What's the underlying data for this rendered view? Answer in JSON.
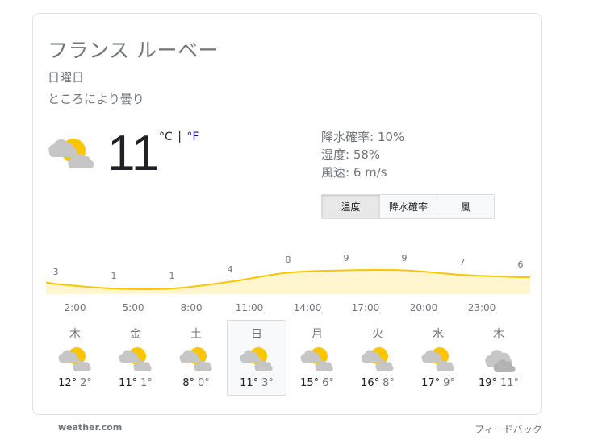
{
  "location": "フランス ルーベー",
  "day": "日曜日",
  "condition": "ところにより曇り",
  "current": {
    "temperature": "11",
    "unit_celsius": "°C",
    "unit_sep": "|",
    "unit_fahrenheit": "°F",
    "icon": "partly-cloudy-icon"
  },
  "details": {
    "precipitation": "降水確率: 10%",
    "humidity": "湿度: 58%",
    "wind": "風速: 6 m/s"
  },
  "tabs": [
    {
      "label": "温度",
      "selected": true
    },
    {
      "label": "降水確率",
      "selected": false
    },
    {
      "label": "風",
      "selected": false
    }
  ],
  "chart_data": {
    "type": "area",
    "x": [
      "2:00",
      "5:00",
      "8:00",
      "11:00",
      "14:00",
      "17:00",
      "20:00",
      "23:00"
    ],
    "values": [
      3,
      1,
      1,
      4,
      8,
      9,
      9,
      7,
      6
    ],
    "value_labels": [
      "3",
      "1",
      "1",
      "4",
      "8",
      "9",
      "9",
      "7",
      "6"
    ],
    "fill_color": "#fff6d0",
    "line_color": "#fbc500"
  },
  "forecast": [
    {
      "day": "木",
      "hi": "12°",
      "lo": "2°",
      "icon": "partly-cloudy-icon"
    },
    {
      "day": "金",
      "hi": "11°",
      "lo": "1°",
      "icon": "partly-cloudy-icon"
    },
    {
      "day": "土",
      "hi": "8°",
      "lo": "0°",
      "icon": "partly-cloudy-icon"
    },
    {
      "day": "日",
      "hi": "11°",
      "lo": "3°",
      "icon": "partly-cloudy-icon",
      "selected": true
    },
    {
      "day": "月",
      "hi": "15°",
      "lo": "6°",
      "icon": "partly-cloudy-icon"
    },
    {
      "day": "火",
      "hi": "16°",
      "lo": "8°",
      "icon": "partly-cloudy-icon"
    },
    {
      "day": "水",
      "hi": "17°",
      "lo": "9°",
      "icon": "partly-cloudy-icon"
    },
    {
      "day": "木",
      "hi": "19°",
      "lo": "11°",
      "icon": "cloudy-icon"
    }
  ],
  "source": "weather.com",
  "feedback": "フィードバック"
}
